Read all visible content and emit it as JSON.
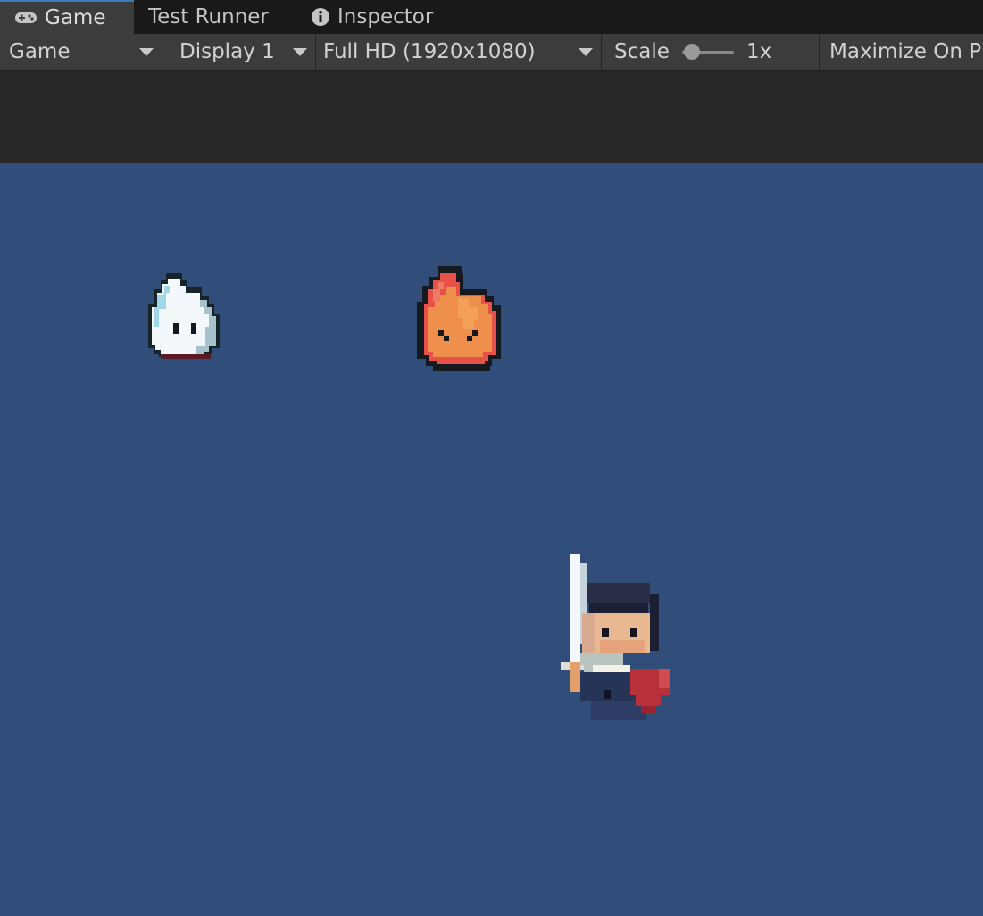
{
  "tabs": [
    {
      "label": "Game",
      "icon": "gamepad-icon",
      "active": true
    },
    {
      "label": "Test Runner",
      "active": false
    },
    {
      "label": "Inspector",
      "icon": "info-icon",
      "active": false
    }
  ],
  "toolbar": {
    "view_select": "Game",
    "display_select": "Display 1",
    "resolution_select": "Full HD (1920x1080)",
    "scale_label": "Scale",
    "scale_value": "1x",
    "maximize_label": "Maximize On Pl"
  },
  "game": {
    "background_color": "#314e7a",
    "sprites": [
      "ice-slime",
      "fire-slime",
      "knight"
    ]
  }
}
